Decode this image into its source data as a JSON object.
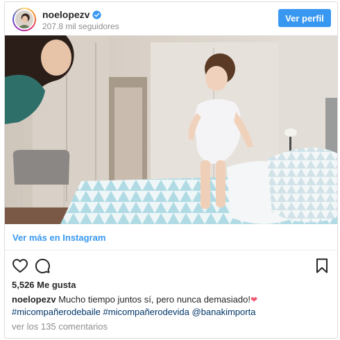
{
  "header": {
    "username": "noelopezv",
    "followers": "207.8 mil seguidores",
    "follow_button": "Ver perfil"
  },
  "post": {
    "view_more_link": "Ver más en Instagram",
    "likes": "5,526 Me gusta",
    "caption": {
      "username": "noelopezv",
      "text": "Mucho tiempo juntos sí, pero nunca demasiado!",
      "emoji": "❤",
      "hashtag1": "#micompañerodebaile",
      "hashtag2": "#micompañerodevida",
      "mention": "@banakimporta"
    },
    "comments_link": "ver los 135 comentarios"
  },
  "icons": {
    "verified": "verified-badge-icon",
    "like": "heart-outline-icon",
    "comment": "speech-bubble-icon",
    "save": "bookmark-icon"
  },
  "colors": {
    "accent": "#3897f0",
    "hashtag": "#003569",
    "muted": "#8e8e8e",
    "border": "#dbdbdb"
  }
}
